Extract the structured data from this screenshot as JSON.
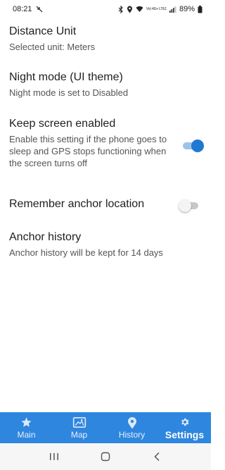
{
  "status_bar": {
    "time": "08:21",
    "network": "Vo) 4G+ LTE1",
    "battery": "89%",
    "icons": [
      "missed-call-icon",
      "bluetooth-icon",
      "location-icon",
      "wifi-icon",
      "signal-icon",
      "battery-icon"
    ]
  },
  "settings": {
    "distance_unit": {
      "title": "Distance Unit",
      "subtitle": "Selected unit: Meters"
    },
    "night_mode": {
      "title": "Night mode (UI theme)",
      "subtitle": "Night mode is set to Disabled"
    },
    "keep_screen": {
      "title": "Keep screen enabled",
      "subtitle": "Enable this setting if the phone goes to sleep and GPS stops functioning when the screen turns off",
      "enabled": true
    },
    "remember_anchor": {
      "title": "Remember anchor location",
      "enabled": false
    },
    "anchor_history": {
      "title": "Anchor history",
      "subtitle": "Anchor history will be kept for 14 days"
    }
  },
  "bottom_nav": {
    "items": [
      {
        "label": "Main",
        "icon": "star-icon"
      },
      {
        "label": "Map",
        "icon": "map-icon"
      },
      {
        "label": "History",
        "icon": "location-pin-icon"
      },
      {
        "label": "Settings",
        "icon": "gear-icon"
      }
    ],
    "active": "Settings"
  },
  "colors": {
    "accent": "#2e86de",
    "toggle_on": "#1f78d1"
  }
}
